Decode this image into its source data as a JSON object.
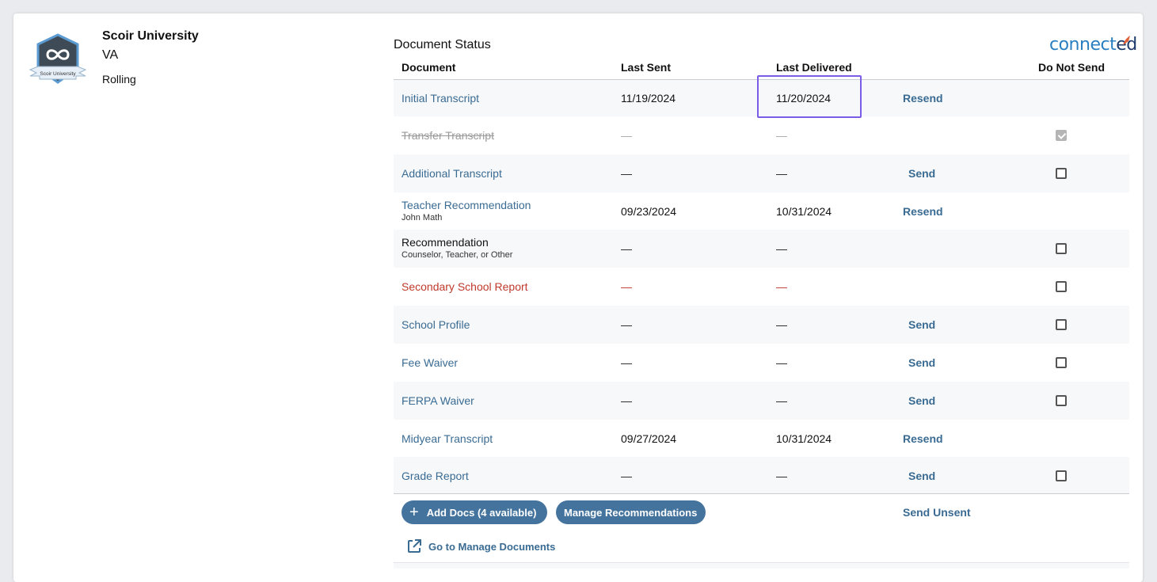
{
  "school": {
    "name": "Scoir University",
    "state": "VA",
    "deadline": "Rolling",
    "logo_text": "Scoir University"
  },
  "brand": {
    "part1": "connect",
    "part2": "ed"
  },
  "section_title": "Document Status",
  "columns": {
    "document": "Document",
    "last_sent": "Last Sent",
    "last_delivered": "Last Delivered",
    "do_not_send": "Do Not Send"
  },
  "rows": [
    {
      "doc": "Initial Transcript",
      "sub": "",
      "style": "link",
      "last_sent": "11/19/2024",
      "last_delivered": "11/20/2024",
      "action": "Resend",
      "checkbox": "none"
    },
    {
      "doc": "Transfer Transcript",
      "sub": "",
      "style": "strike",
      "last_sent": "—",
      "last_delivered": "—",
      "action": "",
      "checkbox": "checked-disabled"
    },
    {
      "doc": "Additional Transcript",
      "sub": "",
      "style": "link",
      "last_sent": "—",
      "last_delivered": "—",
      "action": "Send",
      "checkbox": "unchecked"
    },
    {
      "doc": "Teacher Recommendation",
      "sub": "John Math",
      "style": "link",
      "last_sent": "09/23/2024",
      "last_delivered": "10/31/2024",
      "action": "Resend",
      "checkbox": "none"
    },
    {
      "doc": "Recommendation",
      "sub": "Counselor, Teacher, or Other",
      "style": "plain",
      "last_sent": "—",
      "last_delivered": "—",
      "action": "",
      "checkbox": "unchecked"
    },
    {
      "doc": "Secondary School Report",
      "sub": "",
      "style": "red",
      "last_sent": "—",
      "last_delivered": "—",
      "action": "",
      "checkbox": "unchecked"
    },
    {
      "doc": "School Profile",
      "sub": "",
      "style": "link",
      "last_sent": "—",
      "last_delivered": "—",
      "action": "Send",
      "checkbox": "unchecked"
    },
    {
      "doc": "Fee Waiver",
      "sub": "",
      "style": "link",
      "last_sent": "—",
      "last_delivered": "—",
      "action": "Send",
      "checkbox": "unchecked"
    },
    {
      "doc": "FERPA Waiver",
      "sub": "",
      "style": "link",
      "last_sent": "—",
      "last_delivered": "—",
      "action": "Send",
      "checkbox": "unchecked"
    },
    {
      "doc": "Midyear Transcript",
      "sub": "",
      "style": "link",
      "last_sent": "09/27/2024",
      "last_delivered": "10/31/2024",
      "action": "Resend",
      "checkbox": "none"
    },
    {
      "doc": "Grade Report",
      "sub": "",
      "style": "link",
      "last_sent": "—",
      "last_delivered": "—",
      "action": "Send",
      "checkbox": "unchecked"
    }
  ],
  "footer": {
    "add_docs": "Add Docs (4 available)",
    "manage_recs": "Manage Recommendations",
    "send_unsent": "Send Unsent",
    "go_to_manage": "Go to Manage Documents"
  },
  "colors": {
    "link": "#3a6b93",
    "pill": "#44739e",
    "alert": "#c0392b",
    "highlight": "#7b5ce6"
  }
}
